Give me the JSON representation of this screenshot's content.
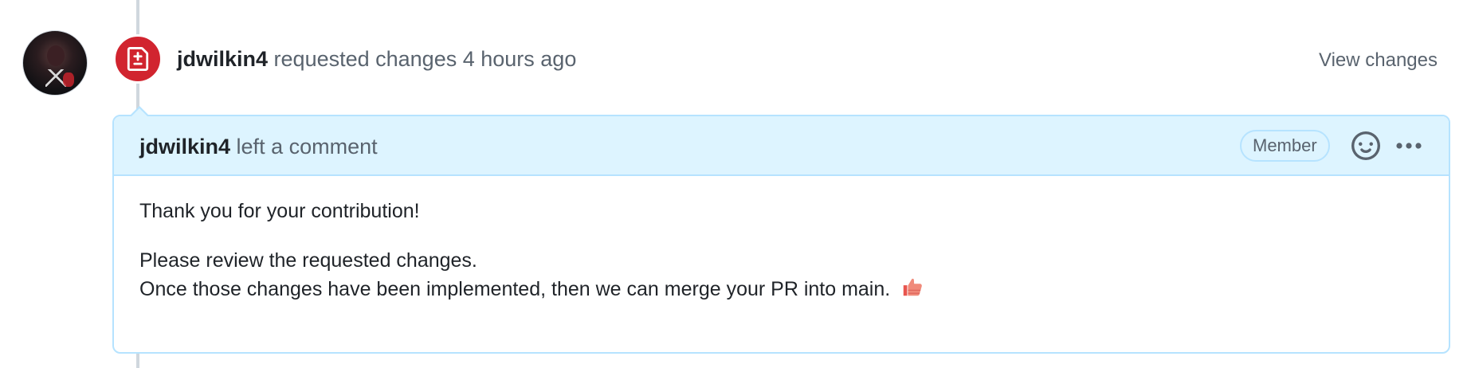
{
  "event": {
    "author": "jdwilkin4",
    "action": "requested changes",
    "time": "4 hours ago",
    "view_changes_label": "View changes",
    "status_color": "#d1242f",
    "icon": "file-diff-icon"
  },
  "comment": {
    "author": "jdwilkin4",
    "action": "left a comment",
    "role_badge": "Member",
    "reaction_icon": "smiley-icon",
    "menu_icon": "kebab-horizontal-icon",
    "body": {
      "line1": "Thank you for your contribution!",
      "line2": "Please review the requested changes.",
      "line3": "Once those changes have been implemented, then we can merge your PR into main.",
      "emoji_icon": "thumbs-up-icon"
    }
  },
  "colors": {
    "header_bg": "#ddf4ff",
    "border": "#b6e3ff",
    "muted_text": "#59636e"
  }
}
